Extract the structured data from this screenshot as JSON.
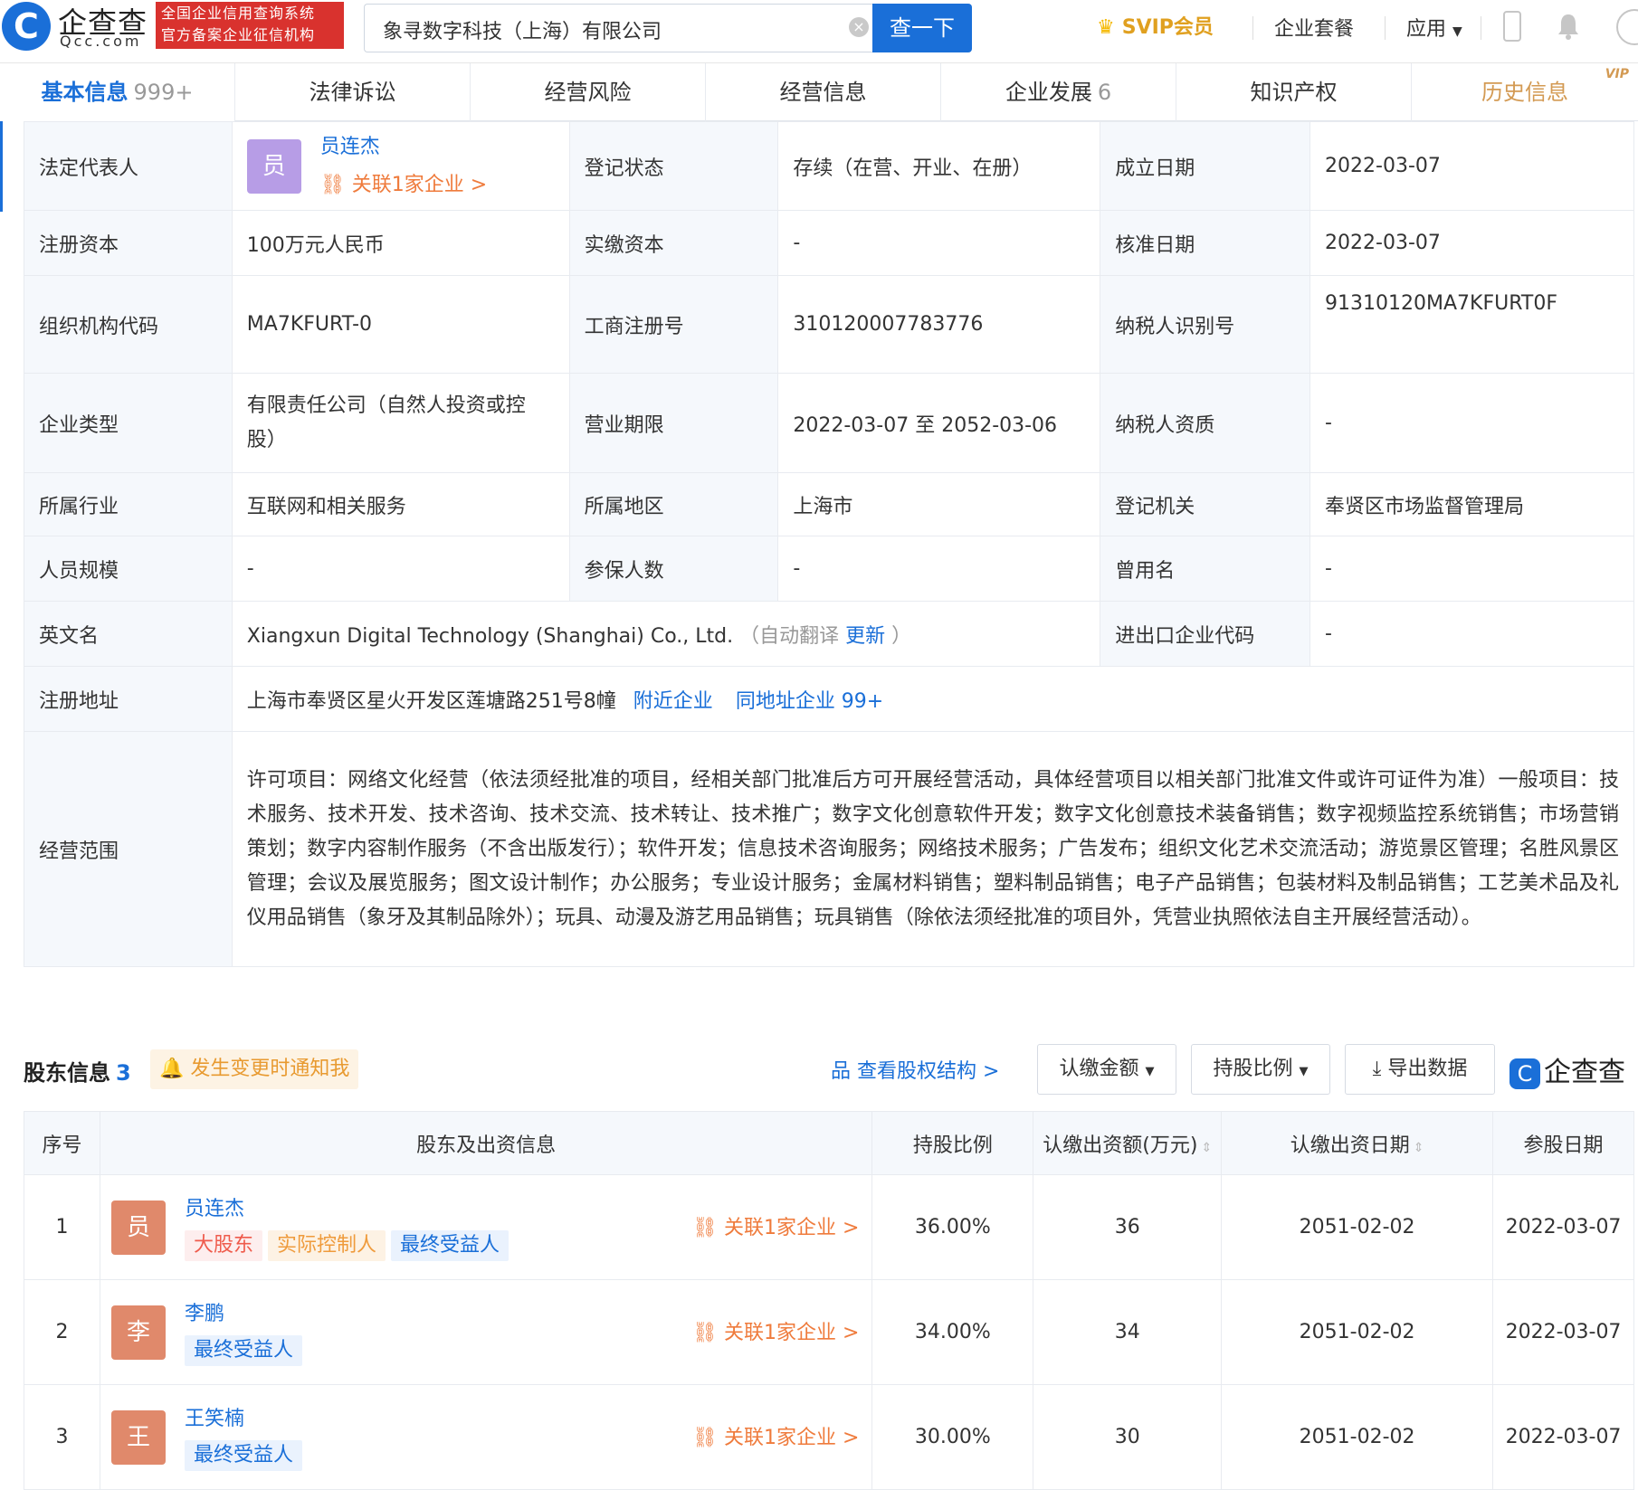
{
  "header": {
    "logo_char": "C",
    "brand": "企查查",
    "brand_sub": "Qcc.com",
    "badge_line1": "全国企业信用查询系统",
    "badge_line2": "官方备案企业征信机构",
    "search_value": "象寻数字科技（上海）有限公司",
    "search_button": "查一下",
    "svip": "SVIP会员",
    "nav_package": "企业套餐",
    "nav_apps": "应用"
  },
  "tabs": [
    {
      "label": "基本信息",
      "count": "999+"
    },
    {
      "label": "法律诉讼",
      "count": ""
    },
    {
      "label": "经营风险",
      "count": ""
    },
    {
      "label": "经营信息",
      "count": ""
    },
    {
      "label": "企业发展",
      "count": "6"
    },
    {
      "label": "知识产权",
      "count": ""
    },
    {
      "label": "历史信息",
      "count": "",
      "sup": "VIP"
    }
  ],
  "info": {
    "legal_rep_label": "法定代表人",
    "legal_rep_avatar": "员",
    "legal_rep_name": "员连杰",
    "legal_rep_link": "关联1家企业 >",
    "reg_status_label": "登记状态",
    "reg_status": "存续（在营、开业、在册）",
    "est_date_label": "成立日期",
    "est_date": "2022-03-07",
    "reg_capital_label": "注册资本",
    "reg_capital": "100万元人民币",
    "paid_capital_label": "实缴资本",
    "paid_capital": "-",
    "approval_date_label": "核准日期",
    "approval_date": "2022-03-07",
    "org_code_label": "组织机构代码",
    "org_code": "MA7KFURT-0",
    "biz_reg_no_label": "工商注册号",
    "biz_reg_no": "310120007783776",
    "taxpayer_id_label": "纳税人识别号",
    "taxpayer_id": "91310120MA7KFURT0F",
    "company_type_label": "企业类型",
    "company_type": "有限责任公司（自然人投资或控股）",
    "biz_term_label": "营业期限",
    "biz_term": "2022-03-07 至 2052-03-06",
    "taxpayer_qual_label": "纳税人资质",
    "taxpayer_qual": "-",
    "industry_label": "所属行业",
    "industry": "互联网和相关服务",
    "region_label": "所属地区",
    "region": "上海市",
    "reg_authority_label": "登记机关",
    "reg_authority": "奉贤区市场监督管理局",
    "staff_size_label": "人员规模",
    "staff_size": "-",
    "insured_label": "参保人数",
    "insured": "-",
    "former_name_label": "曾用名",
    "former_name": "-",
    "english_name_label": "英文名",
    "english_name": "Xiangxun Digital Technology (Shanghai) Co., Ltd.",
    "auto_translate": "（自动翻译",
    "update_link": "更新",
    "auto_translate_end": "）",
    "import_export_label": "进出口企业代码",
    "import_export": "-",
    "address_label": "注册地址",
    "address": "上海市奉贤区星火开发区莲塘路251号8幢",
    "nearby_link": "附近企业",
    "same_address_link": "同地址企业 99+",
    "scope_label": "经营范围",
    "scope": "许可项目：网络文化经营（依法须经批准的项目，经相关部门批准后方可开展经营活动，具体经营项目以相关部门批准文件或许可证件为准）一般项目：技术服务、技术开发、技术咨询、技术交流、技术转让、技术推广；数字文化创意软件开发；数字文化创意技术装备销售；数字视频监控系统销售；市场营销策划；数字内容制作服务（不含出版发行）；软件开发；信息技术咨询服务；网络技术服务；广告发布；组织文化艺术交流活动；游览景区管理；名胜风景区管理；会议及展览服务；图文设计制作；办公服务；专业设计服务；金属材料销售；塑料制品销售；电子产品销售；包装材料及制品销售；工艺美术品及礼仪用品销售（象牙及其制品除外）；玩具、动漫及游艺用品销售；玩具销售（除依法须经批准的项目外，凭营业执照依法自主开展经营活动）。"
  },
  "shareholders": {
    "title": "股东信息",
    "count": "3",
    "notify": "发生变更时通知我",
    "view_structure": "查看股权结构 >",
    "dd_amount": "认缴金额",
    "dd_ratio": "持股比例",
    "export": "导出数据",
    "logo_text": "企查查",
    "headers": {
      "no": "序号",
      "holder": "股东及出资信息",
      "ratio": "持股比例",
      "amount": "认缴出资额(万元)",
      "sub_date": "认缴出资日期",
      "join_date": "参股日期"
    },
    "rows": [
      {
        "no": "1",
        "avatar": "员",
        "name": "员连杰",
        "tags": [
          "大股东",
          "实际控制人",
          "最终受益人"
        ],
        "link": "关联1家企业 >",
        "ratio": "36.00%",
        "amount": "36",
        "sub_date": "2051-02-02",
        "join_date": "2022-03-07"
      },
      {
        "no": "2",
        "avatar": "李",
        "name": "李鹏",
        "tags": [
          "最终受益人"
        ],
        "link": "关联1家企业 >",
        "ratio": "34.00%",
        "amount": "34",
        "sub_date": "2051-02-02",
        "join_date": "2022-03-07"
      },
      {
        "no": "3",
        "avatar": "王",
        "name": "王笑楠",
        "tags": [
          "最终受益人"
        ],
        "link": "关联1家企业 >",
        "ratio": "30.00%",
        "amount": "30",
        "sub_date": "2051-02-02",
        "join_date": "2022-03-07"
      }
    ]
  }
}
